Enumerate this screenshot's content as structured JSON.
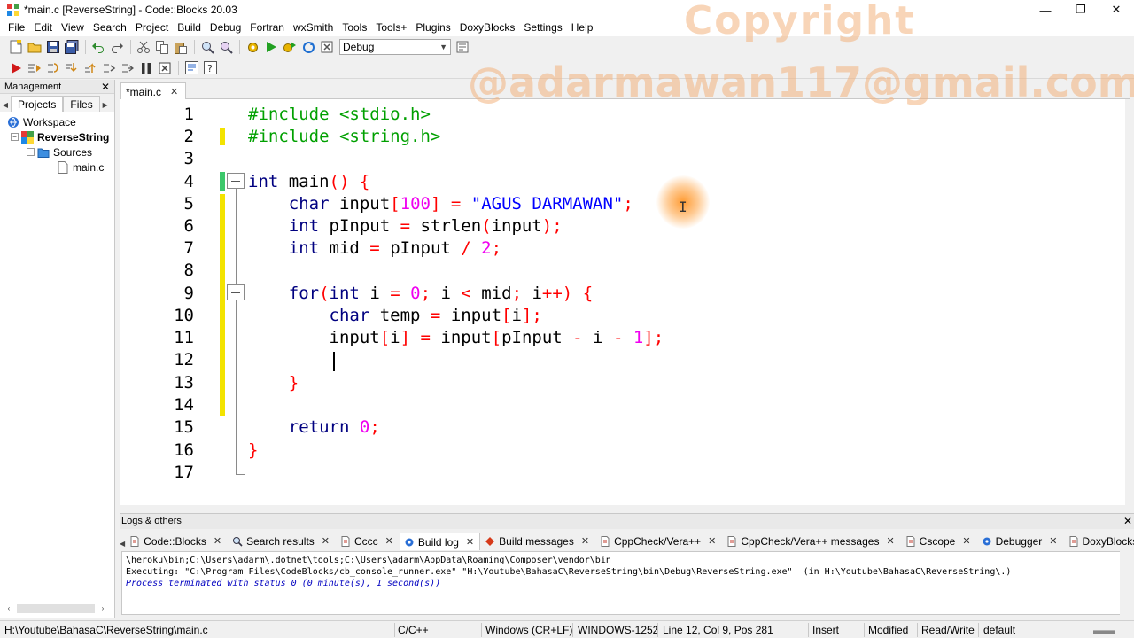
{
  "window": {
    "title": "*main.c [ReverseString] - Code::Blocks 20.03",
    "controls": [
      "—",
      "❐",
      "✕"
    ]
  },
  "menu": [
    "File",
    "Edit",
    "View",
    "Search",
    "Project",
    "Build",
    "Debug",
    "Fortran",
    "wxSmith",
    "Tools",
    "Tools+",
    "Plugins",
    "DoxyBlocks",
    "Settings",
    "Help"
  ],
  "toolbar": {
    "build_target": "Debug"
  },
  "management": {
    "title": "Management",
    "close": "✕",
    "tabs": [
      "Projects",
      "Files"
    ],
    "active_tab": "Projects",
    "tree": [
      {
        "label": "Workspace",
        "level": 0
      },
      {
        "label": "ReverseString",
        "level": 1,
        "bold": true
      },
      {
        "label": "Sources",
        "level": 2
      },
      {
        "label": "main.c",
        "level": 3
      }
    ]
  },
  "editor": {
    "tab_label": "*main.c",
    "tab_close": "✕",
    "line_numbers": [
      "1",
      "2",
      "3",
      "4",
      "5",
      "6",
      "7",
      "8",
      "9",
      "10",
      "11",
      "12",
      "13",
      "14",
      "15",
      "16",
      "17"
    ],
    "lines": [
      "#include <stdio.h>",
      "#include <string.h>",
      "",
      "int main() {",
      "    char input[100] = \"AGUS DARMAWAN\";",
      "    int pInput = strlen(input);",
      "    int mid = pInput / 2;",
      "",
      "    for(int i = 0; i < mid; i++) {",
      "        char temp = input[i];",
      "        input[i] = input[pInput - i - 1];",
      "        ",
      "    }",
      "",
      "    return 0;",
      "}",
      ""
    ],
    "cursor": "I"
  },
  "watermark": {
    "line1": "Copyright",
    "line2": "@adarmawan117@gmail.com"
  },
  "logs": {
    "title": "Logs & others",
    "close": "✕",
    "tabs": [
      {
        "label": "Code::Blocks",
        "icon": "document-icon"
      },
      {
        "label": "Search results",
        "icon": "search-icon"
      },
      {
        "label": "Cccc",
        "icon": "document-icon"
      },
      {
        "label": "Build log",
        "icon": "gear-icon",
        "active": true
      },
      {
        "label": "Build messages",
        "icon": "diamond-icon"
      },
      {
        "label": "CppCheck/Vera++",
        "icon": "document-icon"
      },
      {
        "label": "CppCheck/Vera++ messages",
        "icon": "document-icon"
      },
      {
        "label": "Cscope",
        "icon": "document-icon"
      },
      {
        "label": "Debugger",
        "icon": "gear-icon"
      },
      {
        "label": "DoxyBlocks",
        "icon": "document-icon"
      }
    ],
    "tab_close": "✕",
    "body": [
      "\\heroku\\bin;C:\\Users\\adarm\\.dotnet\\tools;C:\\Users\\adarm\\AppData\\Roaming\\Composer\\vendor\\bin",
      "Executing: \"C:\\Program Files\\CodeBlocks/cb_console_runner.exe\" \"H:\\Youtube\\BahasaC\\ReverseString\\bin\\Debug\\ReverseString.exe\"  (in H:\\Youtube\\BahasaC\\ReverseString\\.)",
      "Process terminated with status 0 (0 minute(s), 1 second(s))"
    ]
  },
  "status": {
    "path": "H:\\Youtube\\BahasaC\\ReverseString\\main.c",
    "language": "C/C++",
    "eol": "Windows (CR+LF)",
    "encoding": "WINDOWS-1252",
    "position": "Line 12, Col 9, Pos 281",
    "mode": "Insert",
    "modified": "Modified",
    "access": "Read/Write",
    "profile": "default"
  }
}
